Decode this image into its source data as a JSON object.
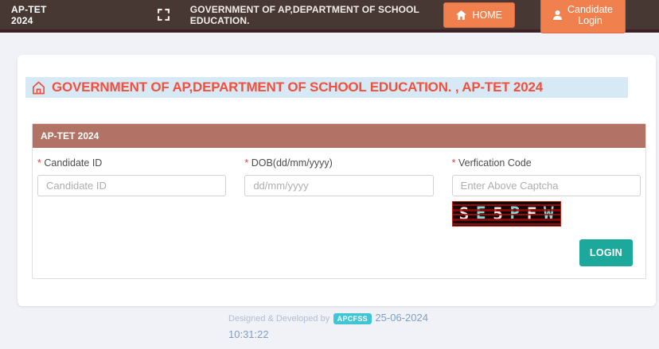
{
  "navbar": {
    "brand": "AP-TET 2024",
    "title": "GOVERNMENT OF AP,DEPARTMENT OF SCHOOL EDUCATION.",
    "home_button": "HOME",
    "candidate_login_button": "Candidate Login"
  },
  "main": {
    "heading": "GOVERNMENT OF AP,DEPARTMENT OF SCHOOL EDUCATION. , AP-TET 2024",
    "panel": {
      "title": "AP-TET 2024",
      "fields": [
        {
          "required_mark": "*",
          "label": "Candidate ID",
          "placeholder": "Candidate ID",
          "value": ""
        },
        {
          "required_mark": "*",
          "label": "DOB(dd/mm/yyyy)",
          "placeholder": "dd/mm/yyyy",
          "value": ""
        },
        {
          "required_mark": "*",
          "label": "Verfication Code",
          "placeholder": "Enter Above Captcha",
          "value": ""
        }
      ],
      "captcha": {
        "code": "SE5PFW",
        "chars": [
          "S",
          "E",
          "5",
          "P",
          "F",
          "W"
        ]
      },
      "login_button": "LOGIN"
    }
  },
  "footer": {
    "credit": "Designed & Developed by",
    "badge": "APCFSS",
    "date": "25-06-2024",
    "time": "10:31:22"
  },
  "icons": {
    "fullscreen": "fullscreen-icon",
    "home_solid": "home-icon",
    "person": "person-icon",
    "home_outline": "home-outline-icon"
  },
  "colors": {
    "navbar_bg": "#473834",
    "navbar_border": "#3e2127",
    "accent_orange": "#f0814f",
    "heading_red": "#f2503d",
    "heading_highlight": "#d8e9f6",
    "panel_header_bg": "#b27366",
    "login_teal": "#1ca99b",
    "badge_cyan": "#3fc6d5",
    "captcha_bg": "#0c0b0b",
    "captcha_stripe_red": "#cc0000",
    "captcha_letter_light": "#e6e6e6",
    "captcha_letter_cyan": "#7bd9d9"
  }
}
